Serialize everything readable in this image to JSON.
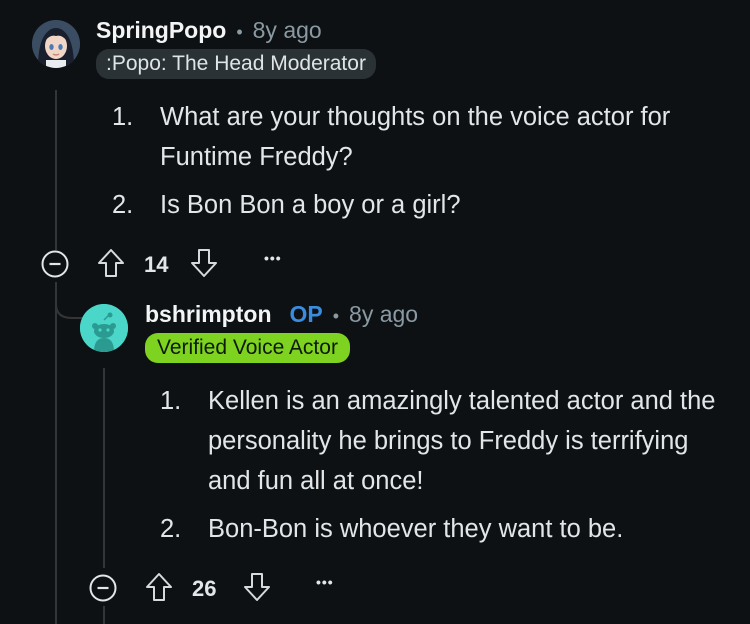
{
  "comment1": {
    "username": "SpringPopo",
    "separator": "•",
    "age": "8y ago",
    "flair": ":Popo: The Head Moderator",
    "items": [
      {
        "num": "1.",
        "text": "What are your thoughts on the voice actor for Funtime Freddy?"
      },
      {
        "num": "2.",
        "text": "Is Bon Bon a boy or a girl?"
      }
    ],
    "score": "14",
    "more": "•••"
  },
  "comment2": {
    "username": "bshrimpton",
    "op_label": "OP",
    "separator": "•",
    "age": "8y ago",
    "flair": "Verified Voice Actor",
    "items": [
      {
        "num": "1.",
        "text": "Kellen is an amazingly talented actor and the personality he brings to Freddy is terrifying and fun all at once!"
      },
      {
        "num": "2.",
        "text": "Bon-Bon is whoever they want to be."
      }
    ],
    "score": "26",
    "more": "•••"
  },
  "colors": {
    "background": "#0e1113",
    "flair_green": "#7ed321",
    "op_blue": "#3a8dde",
    "muted": "#8a9aa3"
  },
  "icons": [
    "collapse-icon",
    "upvote-icon",
    "downvote-icon",
    "more-options-icon",
    "snoo-avatar-icon"
  ]
}
